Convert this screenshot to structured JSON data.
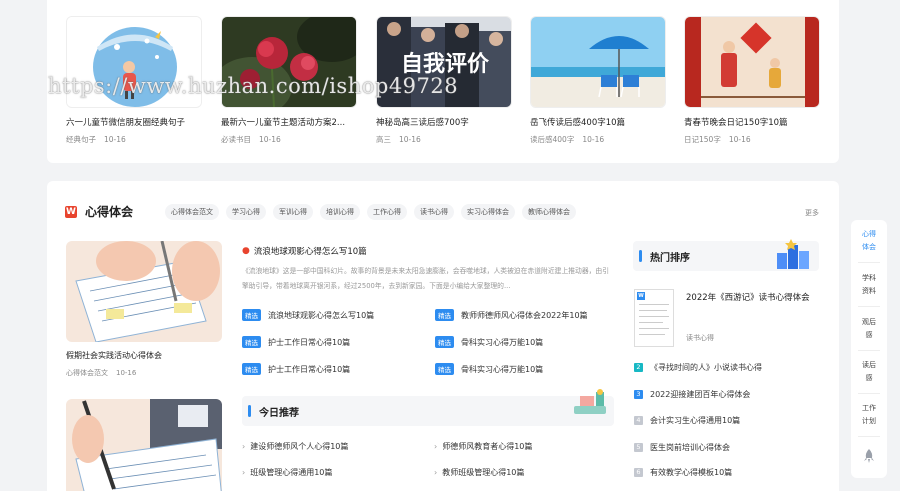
{
  "watermark": "https://www.huzhan.com/ishop49728",
  "top_cards": [
    {
      "title": "六一儿童节微信朋友圈经典句子",
      "category": "经典句子",
      "date": "10-16",
      "image": "child-umbrella-illustration"
    },
    {
      "title": "最新六一儿童节主题活动方案2...",
      "category": "必读书目",
      "date": "10-16",
      "image": "red-flowers-photo"
    },
    {
      "title": "神秘岛高三读后感700字",
      "category": "高三",
      "date": "10-16",
      "image": "business-people-photo",
      "image_text": "自我评价"
    },
    {
      "title": "岳飞传读后感400字10篇",
      "category": "读后感400字",
      "date": "10-16",
      "image": "beach-umbrella-photo"
    },
    {
      "title": "青春节晚会日记150字10篇",
      "category": "日记150字",
      "date": "10-16",
      "image": "spring-festival-illustration"
    }
  ],
  "section": {
    "logo": "W",
    "title": "心得体会",
    "tags": [
      "心得体会范文",
      "学习心得",
      "军训心得",
      "培训心得",
      "工作心得",
      "读书心得",
      "实习心得体会",
      "教师心得体会"
    ],
    "more": "更多"
  },
  "left_cards": [
    {
      "title": "假期社会实践活动心得体会",
      "category": "心得体会范文",
      "date": "10-16",
      "image": "hand-writing-illustration"
    },
    {
      "image": "pen-writing-illustration"
    }
  ],
  "featured": {
    "title": "流浪地球观影心得怎么写10篇",
    "desc": "《流浪地球》这是一部中国科幻片。故事的背景是未来太阳急速膨胀，会吞噬地球，人类被迫在赤道附近建上推动器，由引擎助引导，带着地球离开银河系，经过2500年，去到新家园。下面是小编给大家整理的..."
  },
  "badge_label": "精选",
  "jingxuan": [
    "流浪地球观影心得怎么写10篇",
    "教师师德师风心得体会2022年10篇",
    "护士工作日常心得10篇",
    "骨科实习心得万能10篇",
    "护士工作日常心得10篇",
    "骨科实习心得万能10篇"
  ],
  "today": {
    "title": "今日推荐",
    "items": [
      "建设师德师风个人心得10篇",
      "师德师风教育者心得10篇",
      "班级管理心得通用10篇",
      "教师班级管理心得10篇"
    ]
  },
  "hot": {
    "title": "热门排序",
    "top_title": "2022年《西游记》读书心得体会",
    "top_category": "读书心得",
    "list": [
      {
        "num": "2",
        "title": "《寻找时间的人》小说读书心得"
      },
      {
        "num": "3",
        "title": "2022迎接建团百年心得体会"
      },
      {
        "num": "4",
        "title": "会计实习生心得通用10篇"
      },
      {
        "num": "5",
        "title": "医生岗前培训心得体会"
      },
      {
        "num": "6",
        "title": "有效教学心得模板10篇"
      }
    ]
  },
  "side_nav": [
    {
      "label1": "心得",
      "label2": "体会",
      "active": true
    },
    {
      "label1": "学科",
      "label2": "资料",
      "active": false
    },
    {
      "label1": "观后",
      "label2": "感",
      "active": false
    },
    {
      "label1": "读后",
      "label2": "感",
      "active": false
    },
    {
      "label1": "工作",
      "label2": "计划",
      "active": false
    }
  ],
  "colors": {
    "accent": "#2d8cf0",
    "brand_red": "#e8442e",
    "rank_2": "#17b8c4",
    "rank_3": "#2d8cf0",
    "rank_rest": "#c4c8d0"
  }
}
